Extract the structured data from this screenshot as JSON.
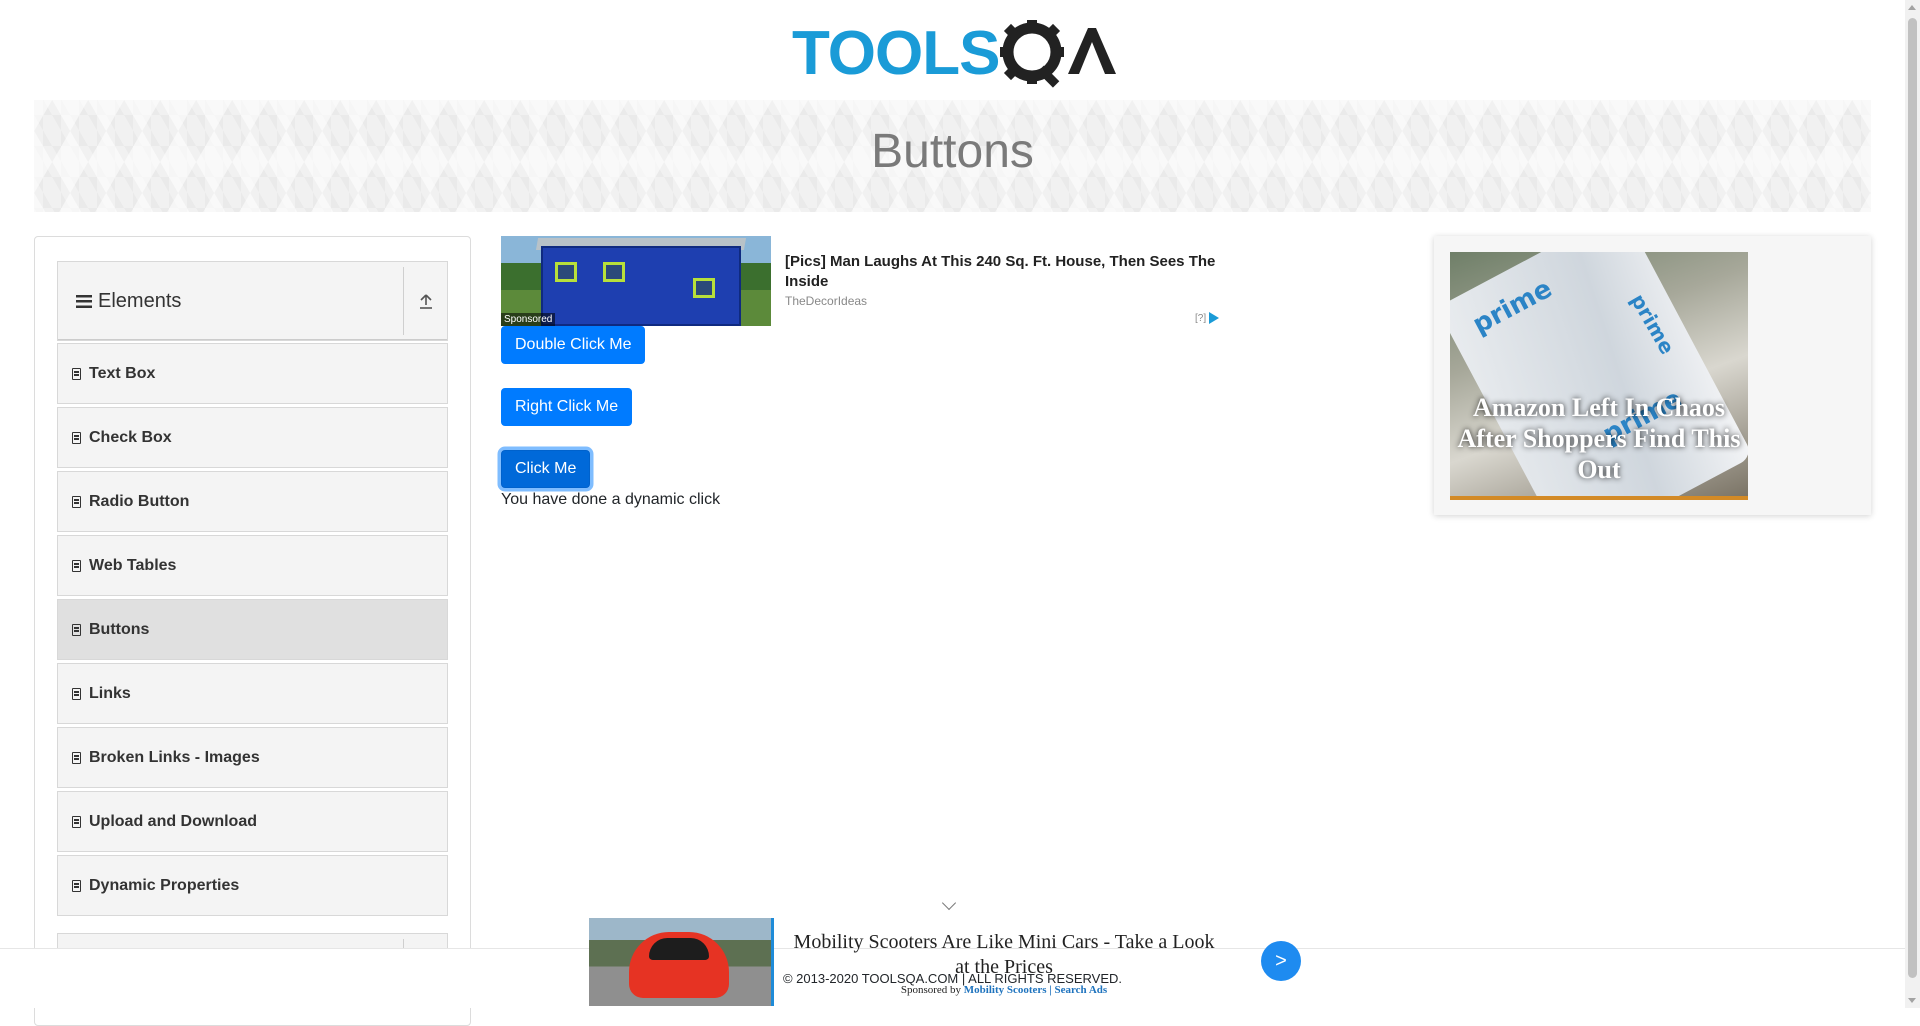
{
  "header": {
    "logo_text": "TOOLSQA"
  },
  "banner": {
    "title": "Buttons"
  },
  "sidebar": {
    "group": {
      "label": "Elements",
      "hamburger_icon": "menu-icon",
      "toggle_icon": "upload-icon"
    },
    "items": [
      {
        "label": "Text Box",
        "active": false
      },
      {
        "label": "Check Box",
        "active": false
      },
      {
        "label": "Radio Button",
        "active": false
      },
      {
        "label": "Web Tables",
        "active": false
      },
      {
        "label": "Buttons",
        "active": true
      },
      {
        "label": "Links",
        "active": false
      },
      {
        "label": "Broken Links - Images",
        "active": false
      },
      {
        "label": "Upload and Download",
        "active": false
      },
      {
        "label": "Dynamic Properties",
        "active": false
      }
    ]
  },
  "ad_top": {
    "sponsored": "Sponsored",
    "headline": "[Pics] Man Laughs At This 240 Sq. Ft. House, Then Sees The Inside",
    "source": "TheDecorIdeas",
    "choice": "[?]"
  },
  "buttons": {
    "double_click": "Double Click Me",
    "right_click": "Right Click Me",
    "click": "Click Me"
  },
  "message": "You have done a dynamic click",
  "ad_right": {
    "headline": "Amazon Left In Chaos After Shoppers Find This Out",
    "brand_word": "prime"
  },
  "ad_bottom": {
    "headline": "Mobility Scooters Are Like Mini Cars - Take a Look at the Prices",
    "sponsor_prefix": "Sponsored by",
    "sponsor_link": "Mobility Scooters | Search Ads",
    "next_label": ">"
  },
  "footer": {
    "copyright": "© 2013-2020 TOOLSQA.COM | ALL RIGHTS RESERVED."
  },
  "colors": {
    "primary": "#007bff",
    "logo_blue": "#1a9bd7",
    "logo_dark": "#222222"
  }
}
